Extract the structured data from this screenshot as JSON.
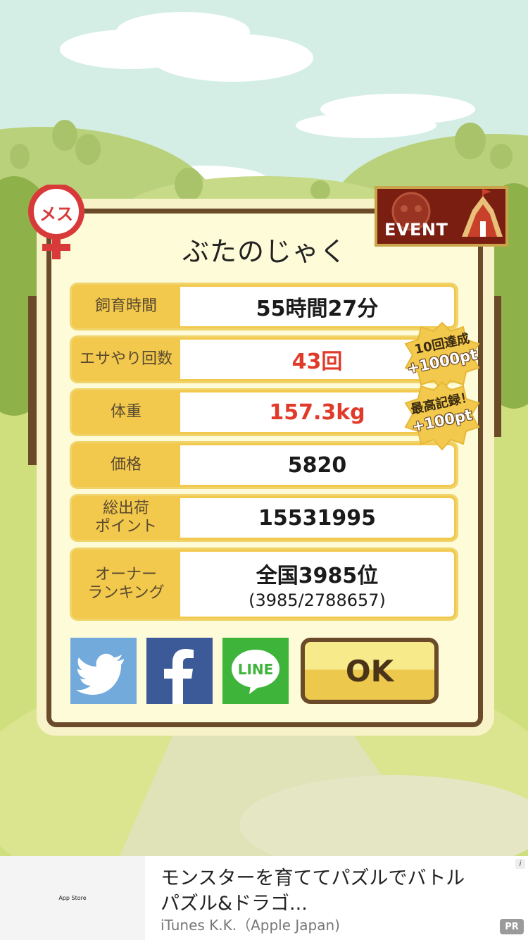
{
  "gender_badge": {
    "label": "メス"
  },
  "title": "ぶたのじゃく",
  "event_button": {
    "label": "EVENT"
  },
  "stats": [
    {
      "label": "飼育時間",
      "value": "55時間27分",
      "highlight": false
    },
    {
      "label": "エサやり回数",
      "value": "43回",
      "highlight": true
    },
    {
      "label": "体重",
      "value": "157.3kg",
      "highlight": true
    },
    {
      "label": "価格",
      "value": "5820",
      "highlight": false
    },
    {
      "label": "総出荷\nポイント",
      "value": "15531995",
      "highlight": false
    },
    {
      "label": "オーナー\nランキング",
      "value": "全国3985位",
      "sub": "(3985/2788657)",
      "highlight": false
    }
  ],
  "bonuses": [
    {
      "line1": "10回達成",
      "line2": "+1000pt"
    },
    {
      "line1": "最高記録！",
      "line2": "+100pt"
    }
  ],
  "share": {
    "twitter_icon": "twitter-bird-icon",
    "facebook_icon": "facebook-f-icon",
    "line_label": "LINE"
  },
  "ok_button": {
    "label": "OK"
  },
  "ad": {
    "thumb_label": "App Store",
    "headline": "モンスターを育ててパズルでバトル パズル&ドラゴ...",
    "advertiser": "iTunes K.K.（Apple Japan)",
    "info": "i",
    "pr": "PR"
  },
  "colors": {
    "accent_red": "#e03a2a",
    "frame_brown": "#6b4a2a",
    "label_gold": "#f2c94c",
    "twitter": "#73aadc",
    "facebook": "#3d5a98",
    "line": "#3fb43a"
  }
}
